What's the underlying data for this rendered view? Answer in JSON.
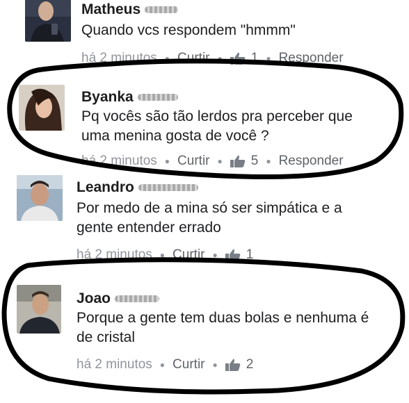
{
  "comments": [
    {
      "author": "Matheus",
      "text_lines": [
        "Quando vcs respondem \"hmmm\""
      ],
      "time": "há 2 minutos",
      "like_action": "Curtir",
      "likes": "1",
      "reply_action": "Responder"
    },
    {
      "author": "Byanka",
      "text_lines": [
        "Pq vocês são tão lerdos pra perceber que",
        "uma menina gosta de você ?"
      ],
      "time": "há 2 minutos",
      "like_action": "Curtir",
      "likes": "5",
      "reply_action": "Responder"
    },
    {
      "author": "Leandro",
      "text_lines": [
        "Por medo de a mina só ser simpática e a",
        "gente entender errado"
      ],
      "time": "há 2 minutos",
      "like_action": "Curtir",
      "likes": "1"
    },
    {
      "author": "Joao",
      "text_lines": [
        "Porque a gente tem duas bolas e nenhuma é",
        "de cristal"
      ],
      "time": "há 2 minutos",
      "like_action": "Curtir",
      "likes": "2"
    }
  ],
  "colors": {
    "meta_gray": "#90949c",
    "circle_stroke": "#000000",
    "like_icon": "#7a7f87"
  },
  "icons": [
    "thumbs-up-icon"
  ]
}
